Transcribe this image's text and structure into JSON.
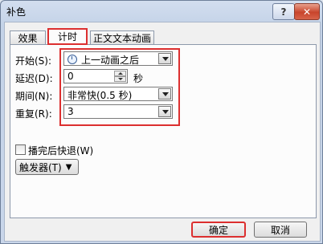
{
  "window": {
    "title": "补色",
    "help_label": "?",
    "close_label": "✕"
  },
  "tabs": [
    {
      "label": "效果"
    },
    {
      "label": "计时"
    },
    {
      "label": "正文文本动画"
    }
  ],
  "fields": {
    "start": {
      "label": "开始(S):",
      "value": "上一动画之后",
      "icon": "clock-icon"
    },
    "delay": {
      "label": "延迟(D):",
      "value": "0",
      "unit": "秒"
    },
    "duration": {
      "label": "期间(N):",
      "value": "非常快(0.5 秒)"
    },
    "repeat": {
      "label": "重复(R):",
      "value": "3"
    }
  },
  "rewind_checkbox": {
    "label": "播完后快退(W)",
    "checked": false
  },
  "trigger_button": {
    "label": "触发器(T)",
    "arrow": "▼"
  },
  "buttons": {
    "ok": "确定",
    "cancel": "取消"
  },
  "colors": {
    "highlight": "#dc2f2f"
  }
}
